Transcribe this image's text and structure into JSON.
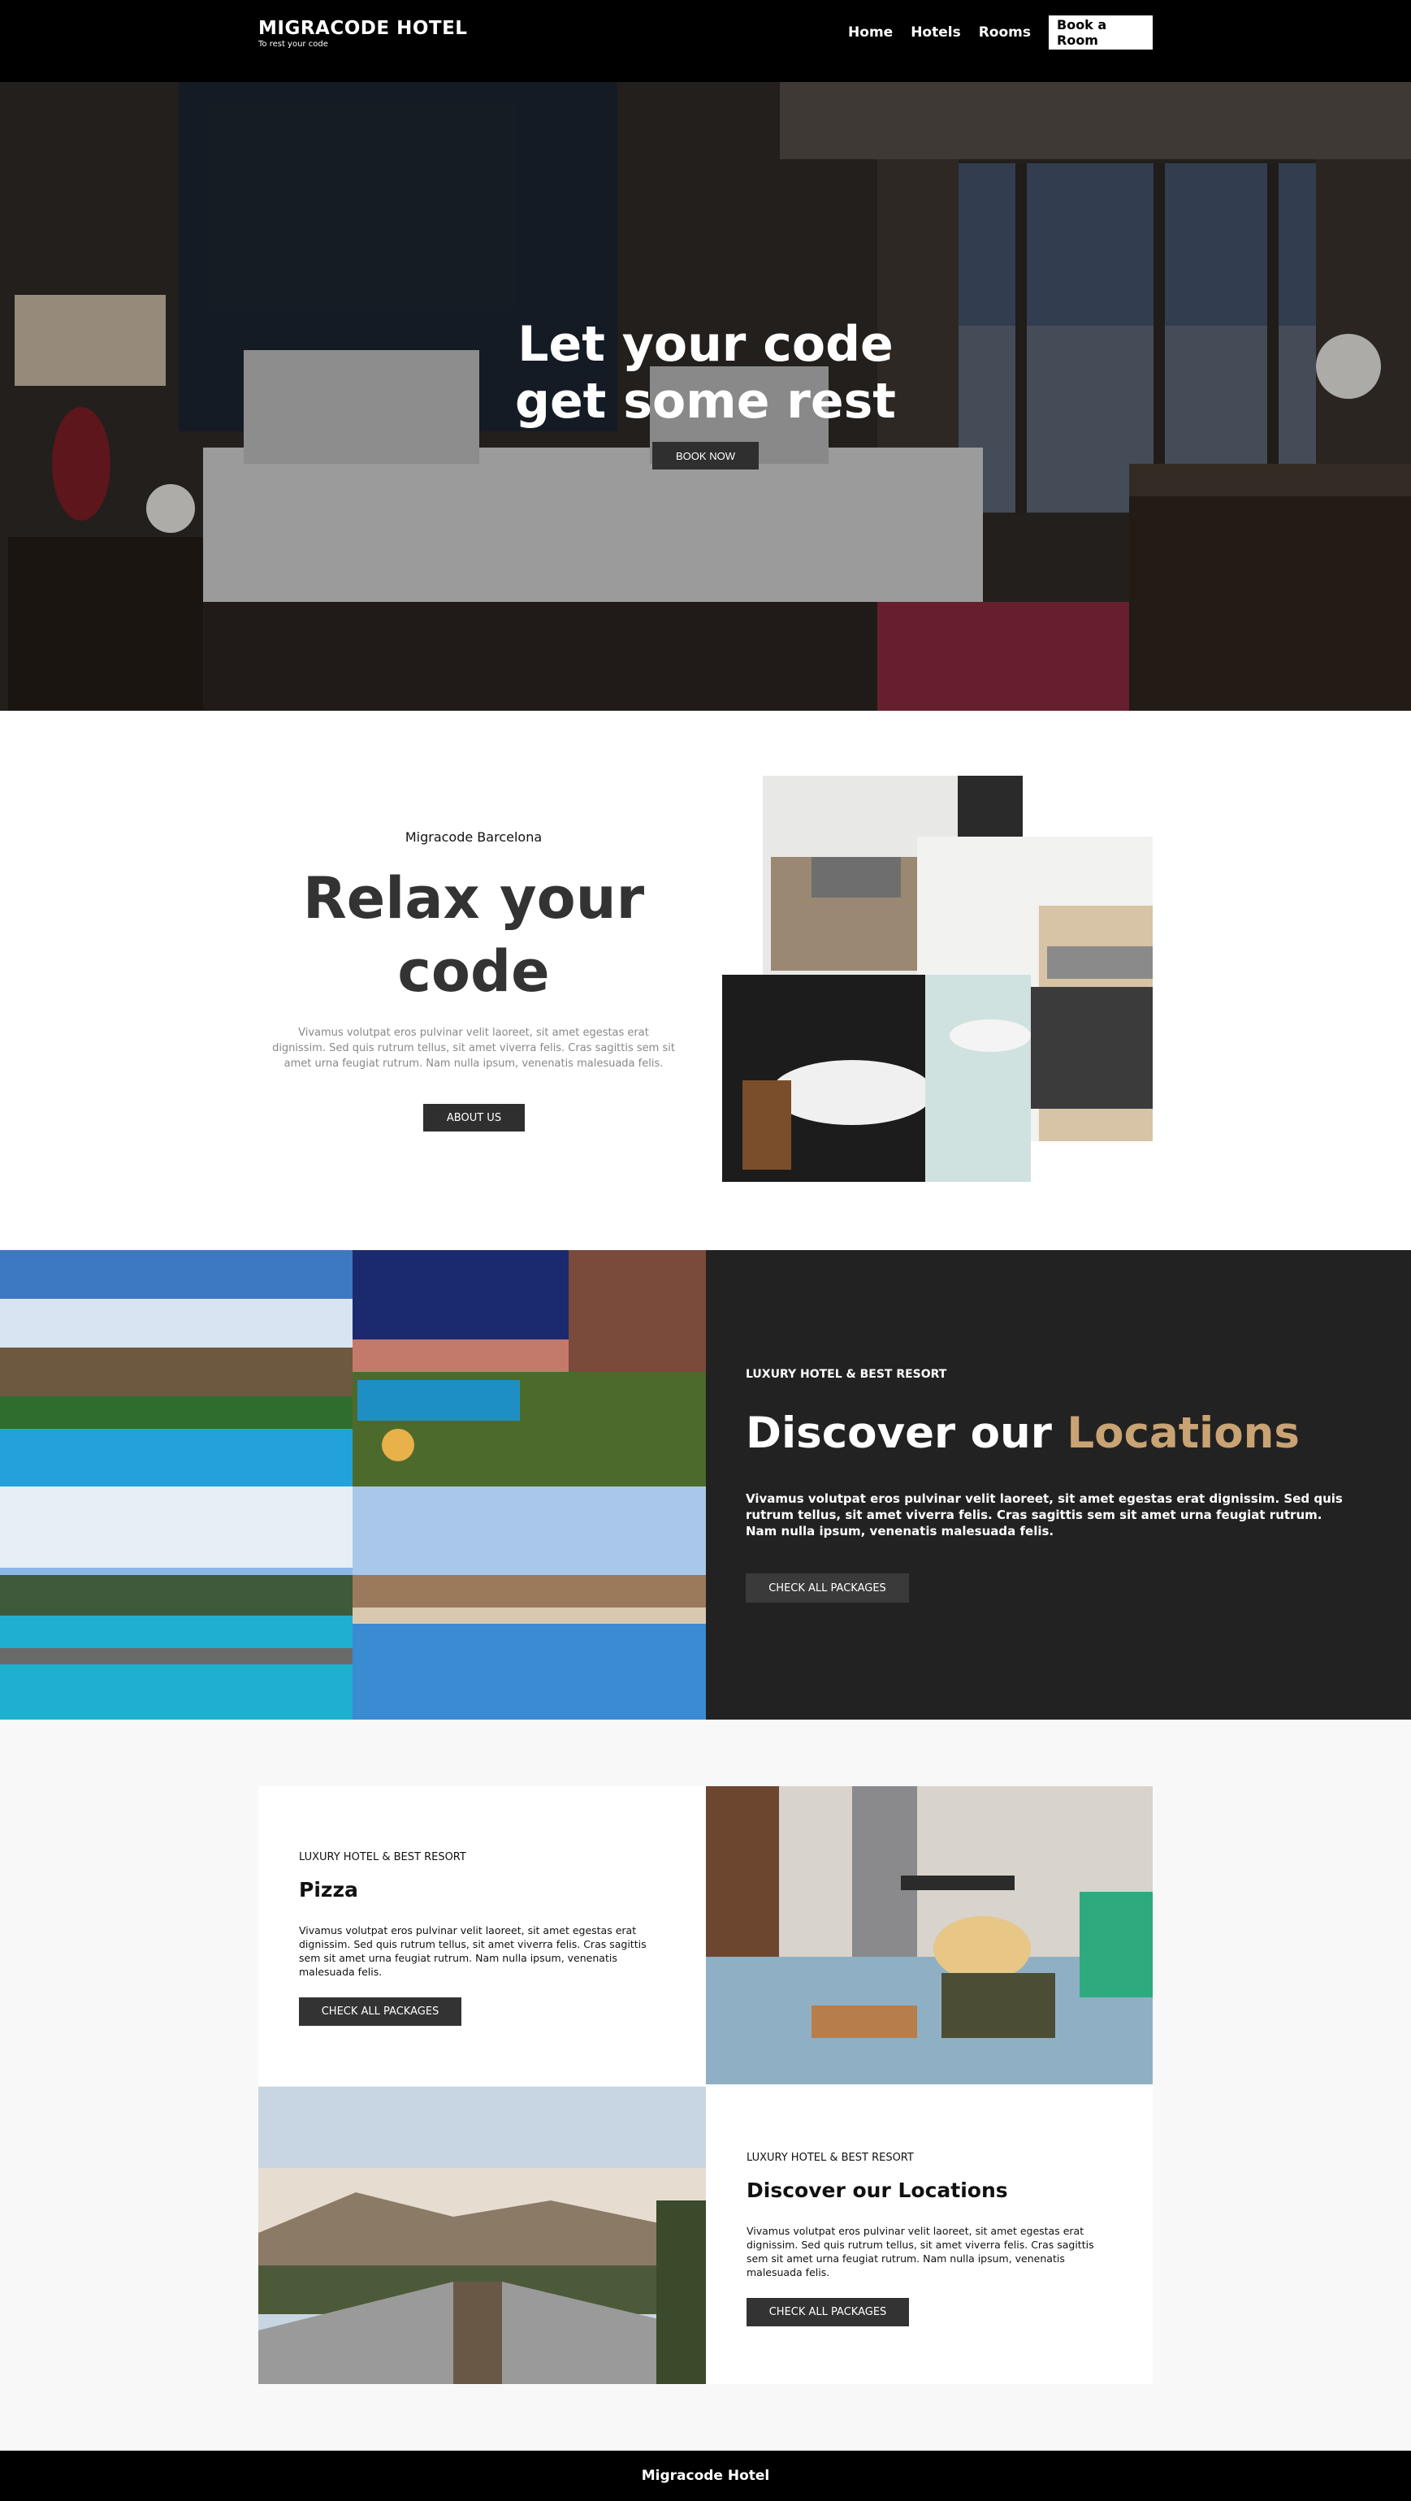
{
  "header": {
    "brand_title": "MIGRACODE HOTEL",
    "brand_tagline": "To rest your code",
    "nav": [
      "Home",
      "Hotels",
      "Rooms"
    ],
    "cta": "Book a Room"
  },
  "hero": {
    "title_line1": "Let your code",
    "title_line2": "get some rest",
    "button": "BOOK NOW"
  },
  "relax": {
    "subtitle": "Migracode Barcelona",
    "title_line1": "Relax your",
    "title_line2": "code",
    "text": "Vivamus volutpat eros pulvinar velit laoreet, sit amet egestas erat dignissim. Sed quis rutrum tellus, sit amet viverra felis. Cras sagittis sem sit amet urna feugiat rutrum. Nam nulla ipsum, venenatis malesuada felis.",
    "button": "ABOUT US"
  },
  "locations": {
    "eyebrow": "LUXURY HOTEL & BEST RESORT",
    "title_main": "Discover our ",
    "title_accent": "Locations",
    "text": "Vivamus volutpat eros pulvinar velit laoreet, sit amet egestas erat dignissim. Sed quis rutrum tellus, sit amet viverra felis. Cras sagittis sem sit amet urna feugiat rutrum. Nam nulla ipsum, venenatis malesuada felis.",
    "button": "CHECK ALL PACKAGES",
    "accent_color": "#c9a373"
  },
  "cards": [
    {
      "eyebrow": "LUXURY HOTEL & BEST RESORT",
      "title": "Pizza",
      "text": "Vivamus volutpat eros pulvinar velit laoreet, sit amet egestas erat dignissim. Sed quis rutrum tellus, sit amet viverra felis. Cras sagittis sem sit amet urna feugiat rutrum. Nam nulla ipsum, venenatis malesuada felis.",
      "button": "CHECK ALL PACKAGES"
    },
    {
      "eyebrow": "LUXURY HOTEL & BEST RESORT",
      "title": "Discover our Locations",
      "text": "Vivamus volutpat eros pulvinar velit laoreet, sit amet egestas erat dignissim. Sed quis rutrum tellus, sit amet viverra felis. Cras sagittis sem sit amet urna feugiat rutrum. Nam nulla ipsum, venenatis malesuada felis.",
      "button": "CHECK ALL PACKAGES"
    }
  ],
  "footer": {
    "text": "Migracode Hotel"
  }
}
